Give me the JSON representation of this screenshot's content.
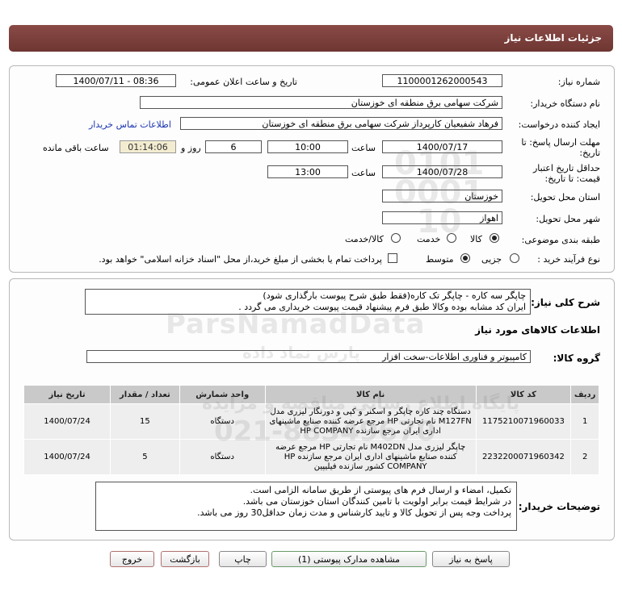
{
  "header": {
    "title": "جزئیات اطلاعات نیاز"
  },
  "form": {
    "need_number_label": "شماره نیاز:",
    "need_number": "1100001262000543",
    "announce_label": "تاریخ و ساعت اعلان عمومی:",
    "announce_value": "1400/07/11 - 08:36",
    "buyer_org_label": "نام دستگاه خریدار:",
    "buyer_org": "شرکت سهامی برق منطقه ای خوزستان",
    "creator_label": "ایجاد کننده درخواست:",
    "creator": "فرهاد شفیعیان کارپرداز شرکت سهامی برق منطقه ای خوزستان",
    "contact_link": "اطلاعات تماس خریدار",
    "reply_deadline_label_1": "مهلت ارسال پاسخ: تا",
    "reply_deadline_label_2": "تاریخ:",
    "reply_date": "1400/07/17",
    "time_word": "ساعت",
    "reply_time": "10:00",
    "days_value": "6",
    "days_and": "روز و",
    "remaining_time": "01:14:06",
    "remaining_label": "ساعت باقی مانده",
    "validity_label_1": "حداقل تاریخ اعتبار",
    "validity_label_2": "قیمت: تا تاریخ:",
    "validity_date": "1400/07/28",
    "validity_time": "13:00",
    "province_label": "استان محل تحویل:",
    "province": "خوزستان",
    "city_label": "شهر محل تحویل:",
    "city": "اهواز",
    "category_label": "طبقه بندی موضوعی:",
    "category_options": [
      "کالا",
      "خدمت",
      "کالا/خدمت"
    ],
    "category_selected": "کالا",
    "process_label": "نوع فرآیند خرید :",
    "process_options": [
      "جزیی",
      "متوسط"
    ],
    "process_selected": "متوسط",
    "payment_note": "پرداخت تمام یا بخشی از مبلغ خرید،از محل \"اسناد خزانه اسلامی\" خواهد بود."
  },
  "description": {
    "label": "شرح کلی نیاز:",
    "line1": "چاپگر سه کاره - چاپگر تک کاره(فقط طبق شرح پیوست بارگذاری شود)",
    "line2": "ایران کد مشابه بوده وکالا طبق فرم پیشنهاد قیمت پیوست خریداری می گردد ."
  },
  "goods": {
    "section_title": "اطلاعات کالاهای مورد نیاز",
    "group_label": "گروه کالا:",
    "group_value": "کامپیوتر و فناوری اطلاعات-سخت افزار",
    "columns": [
      "ردیف",
      "کد کالا",
      "نام کالا",
      "واحد شمارش",
      "تعداد / مقدار",
      "تاریخ نیاز"
    ],
    "rows": [
      {
        "row": "1",
        "code": "1175210071960033",
        "name": "دستگاه چند کاره چاپگر و اسکنر و کپی و دورنگار لیزری مدل M127FN نام تجارتی HP مرجع عرضه کننده صنایع ماشینهای اداری ایران مرجع سازنده HP COMPANY",
        "unit": "دستگاه",
        "qty": "15",
        "date": "1400/07/24"
      },
      {
        "row": "2",
        "code": "2232200071960342",
        "name": "چاپگر لیزری مدل M402DN نام تجارتی HP مرجع عرضه کننده صنایع ماشینهای اداری ایران مرجع سازنده HP COMPANY کشور سازنده فیلیپین",
        "unit": "دستگاه",
        "qty": "5",
        "date": "1400/07/24"
      }
    ]
  },
  "buyer_notes": {
    "label": "توضیحات خریدار:",
    "line1": "تکمیل، امضاء و ارسال فرم های پیوستی از طریق سامانه الزامی است.",
    "line2": "در شرایط  قیمت برابر اولویت با تامین کنندگان استان خوزستان می باشد.",
    "line3": "پرداخت وجه پس از تحویل کالا و تایید کارشناس و مدت زمان حداقل30 روز می باشد."
  },
  "buttons": {
    "reply": "پاسخ به نیاز",
    "attachments": "مشاهده مدارک پیوستی (1)",
    "print": "چاپ",
    "back": "بازگشت",
    "exit": "خروج"
  },
  "watermark": {
    "brand": "ParsNamadData",
    "brand_fa": "پارس نماد داده",
    "portal": "پایگاه اطلاع رسانی مناقصه و مزایده",
    "phone": "021-88349670",
    "stamp": "0101\n0001\n10"
  }
}
